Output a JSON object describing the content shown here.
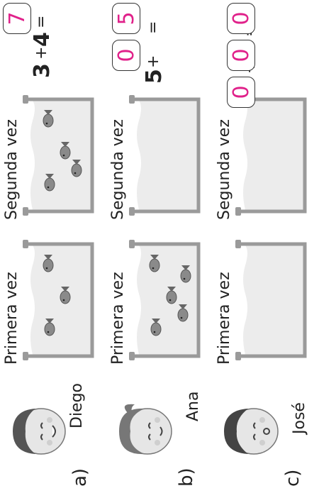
{
  "rows": [
    {
      "letter": "a)",
      "name": "Diego",
      "first_label": "Primera vez",
      "first_fish": 3,
      "second_label": "Segunda vez",
      "second_fish": 4,
      "equation": {
        "addend1": "3",
        "plus": "+",
        "addend2": "4",
        "equals": "=",
        "result": "7"
      }
    },
    {
      "letter": "b)",
      "name": "Ana",
      "first_label": "Primera vez",
      "first_fish": 5,
      "second_label": "Segunda vez",
      "second_fish": 0,
      "equation": {
        "addend1": "5",
        "plus": "+",
        "addend2": "0",
        "equals": "=",
        "result": "5"
      }
    },
    {
      "letter": "c)",
      "name": "José",
      "first_label": "Primera vez",
      "first_fish": 0,
      "second_label": "Segunda vez",
      "second_fish": 0,
      "equation": {
        "addend1": "0",
        "plus": "+",
        "addend2": "0",
        "equals": "=",
        "result": "0"
      }
    }
  ],
  "colors": {
    "answer": "#e0218a",
    "text": "#222222"
  }
}
